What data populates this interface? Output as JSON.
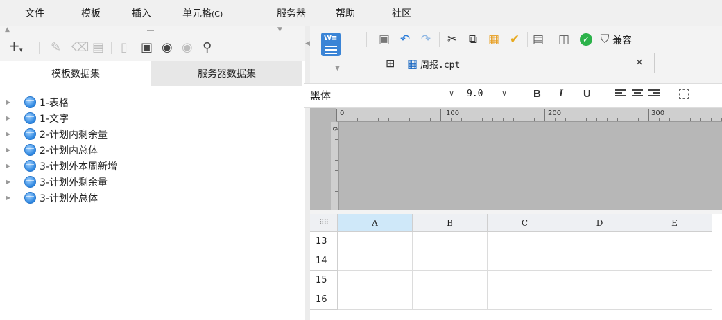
{
  "menu": {
    "file": "文件",
    "template": "模板",
    "insert": "插入",
    "cell": "单元格",
    "cell_hint": "(C)",
    "server": "服务器",
    "help": "帮助",
    "community": "社区"
  },
  "left_panel": {
    "tabs": {
      "template_datasets": "模板数据集",
      "server_datasets": "服务器数据集"
    },
    "active_tab": "template_datasets",
    "datasets": [
      "1-表格",
      "1-文字",
      "2-计划内剩余量",
      "2-计划内总体",
      "3-计划外本周新增",
      "3-计划外剩余量",
      "3-计划外总体"
    ],
    "icons": {
      "add": "plus-icon",
      "edit": "pencil-icon",
      "delete": "trash-icon",
      "copy": "copy-icon",
      "preview": "preview-icon",
      "server_dataset": "dataset-icon",
      "search": "search-icon"
    }
  },
  "toolbar": {
    "compat_label": "兼容",
    "icons": [
      "save-icon",
      "undo-icon",
      "redo-icon",
      "cut-icon",
      "copy-icon",
      "paste-icon",
      "format-brush-icon",
      "template-params-icon",
      "preview-icon",
      "check-icon",
      "compat-icon"
    ]
  },
  "file_tab": {
    "name": "周报.cpt",
    "close": "×"
  },
  "format": {
    "font": "黑体",
    "size": "9.0",
    "bold": "B",
    "italic": "I",
    "underline": "U"
  },
  "ruler": {
    "labels": [
      "0",
      "100",
      "200",
      "300"
    ],
    "left_label": "0"
  },
  "sheet": {
    "corner": "⠿⠿",
    "columns": [
      "A",
      "B",
      "C",
      "D",
      "E"
    ],
    "selected_column": "A",
    "rows": [
      "13",
      "14",
      "15",
      "16"
    ]
  },
  "colors": {
    "accent": "#2a7bd8",
    "selected_column": "#cfe8f9",
    "canvas_gray": "#b7b7b7"
  }
}
